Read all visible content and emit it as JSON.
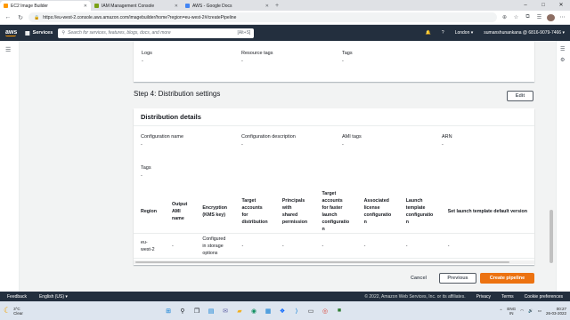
{
  "browser": {
    "tabs": [
      {
        "title": "EC2 Image Builder",
        "color": "#ff9900",
        "active": true
      },
      {
        "title": "IAM Management Console",
        "color": "#7aa116",
        "active": false
      },
      {
        "title": "AWS - Google Docs",
        "color": "#4285f4",
        "active": false
      }
    ],
    "new_tab": "+",
    "url": "https://eu-west-2.console.aws.amazon.com/imagebuilder/home?region=eu-west-2#/createPipeline"
  },
  "aws_header": {
    "logo": "aws",
    "services_label": "Services",
    "search_placeholder": "Search for services, features, blogs, docs, and more",
    "search_shortcut": "[Alt+S]",
    "region": "London ▾",
    "account": "sumanshunankana @ 6816-9079-7466 ▾"
  },
  "previous_panel": {
    "fields": [
      {
        "label": "Logs",
        "value": "-"
      },
      {
        "label": "Resource tags",
        "value": "-"
      },
      {
        "label": "Tags",
        "value": "-"
      }
    ]
  },
  "step4": {
    "title": "Step 4: Distribution settings",
    "edit_label": "Edit",
    "panel_title": "Distribution details",
    "fields": [
      {
        "label": "Configuration name",
        "value": "-"
      },
      {
        "label": "Configuration description",
        "value": "-"
      },
      {
        "label": "AMI tags",
        "value": "-"
      },
      {
        "label": "ARN",
        "value": "-"
      }
    ],
    "tags": {
      "label": "Tags",
      "value": "-"
    },
    "table": {
      "headers": [
        "Region",
        "Output AMI name",
        "Encryption (KMS key)",
        "Target accounts for distribution",
        "Principals with shared permission",
        "Target accounts for faster launch configuratio n",
        "Associated license configuratio n",
        "Launch template configuratio n",
        "Set launch template default version"
      ],
      "row": [
        "eu-west-2",
        "-",
        "Configured in storage options",
        "-",
        "-",
        "-",
        "-",
        "-",
        "-"
      ]
    }
  },
  "actions": {
    "cancel": "Cancel",
    "previous": "Previous",
    "create": "Create pipeline"
  },
  "footer": {
    "feedback": "Feedback",
    "language": "English (US) ▾",
    "copyright": "© 2022, Amazon Web Services, Inc. or its affiliates.",
    "privacy": "Privacy",
    "terms": "Terms",
    "cookies": "Cookie preferences"
  },
  "taskbar": {
    "temp": "3°C",
    "condition": "Clear",
    "lang_top": "ENG",
    "lang_bottom": "IN",
    "time": "00:27",
    "date": "26-03-2022"
  }
}
